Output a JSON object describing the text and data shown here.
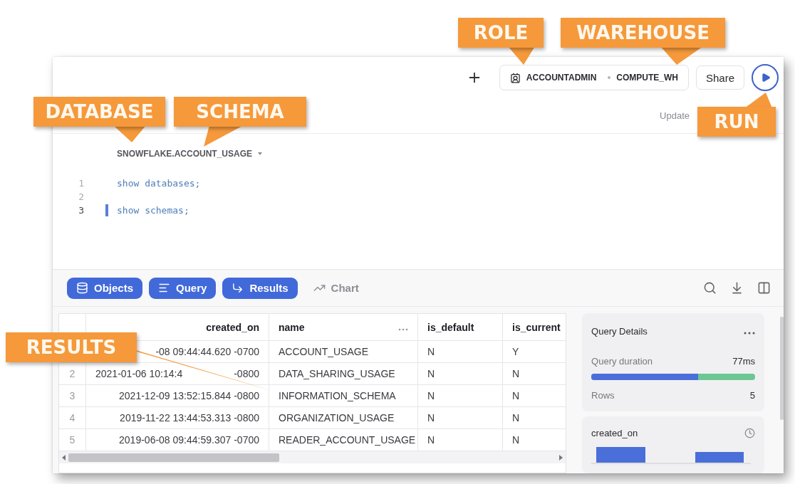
{
  "callouts": [
    {
      "label": "ROLE"
    },
    {
      "label": "WAREHOUSE"
    },
    {
      "label": "DATABASE"
    },
    {
      "label": "SCHEMA"
    },
    {
      "label": "RUN"
    },
    {
      "label": "RESULTS"
    }
  ],
  "toolbar": {
    "role": "ACCOUNTADMIN",
    "warehouse": "COMPUTE_WH",
    "share": "Share"
  },
  "updated": "Update",
  "context": "SNOWFLAKE.ACCOUNT_USAGE",
  "editor": {
    "lines": [
      {
        "number": "1",
        "code": "show databases;",
        "active": false
      },
      {
        "number": "2",
        "active": false
      },
      {
        "number": "3",
        "code": "show schemas;",
        "active": true
      }
    ]
  },
  "panel_tabs": [
    {
      "label": "Objects",
      "selected": true
    },
    {
      "label": "Query",
      "selected": true
    },
    {
      "label": "Results",
      "selected": true
    },
    {
      "label": "Chart",
      "selected": false
    }
  ],
  "table": {
    "columns": [
      "created_on",
      "name",
      "is_default",
      "is_current"
    ],
    "rows": [
      {
        "cells": [
          "-08 09:44:44.620 -0700",
          "ACCOUNT_USAGE",
          "N",
          "Y"
        ]
      },
      {
        "number": "2",
        "cells": [
          {
            "before": "2021-01-06 10:14:4",
            "after": "-0800"
          },
          "DATA_SHARING_USAGE",
          "N",
          "N"
        ]
      },
      {
        "number": "3",
        "cells": [
          "2021-12-09 13:52:15.844 -0800",
          "INFORMATION_SCHEMA",
          "N",
          "N"
        ]
      },
      {
        "number": "4",
        "cells": [
          "2019-11-22 13:44:53.313 -0800",
          "ORGANIZATION_USAGE",
          "N",
          "N"
        ]
      },
      {
        "number": "5",
        "cells": [
          "2019-06-08 09:44:59.307 -0700",
          "READER_ACCOUNT_USAGE",
          "N",
          "N"
        ]
      }
    ]
  },
  "query_details": {
    "title": "Query Details",
    "duration_label": "Query duration",
    "duration": "77ms",
    "level": 0.65,
    "rows_label": "Rows",
    "rows": "5"
  },
  "column_card": {
    "title": "created_on"
  }
}
